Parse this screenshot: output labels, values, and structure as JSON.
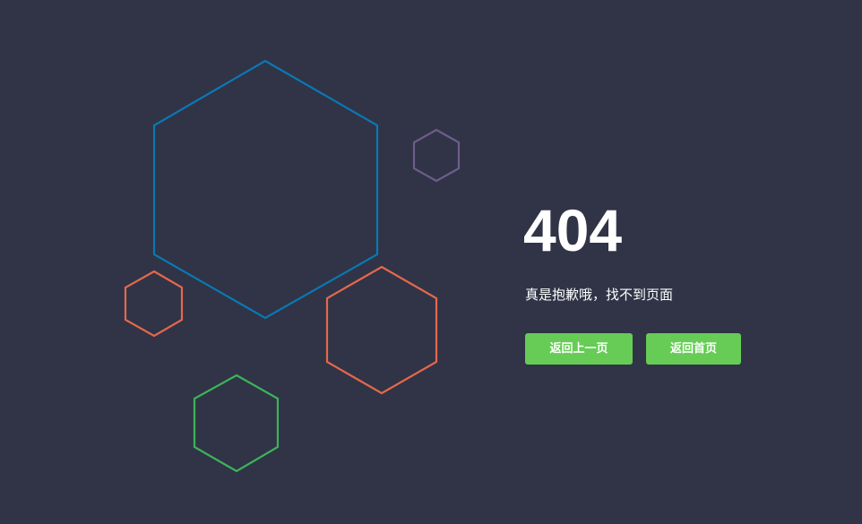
{
  "error": {
    "code": "404",
    "message": "真是抱歉哦，找不到页面"
  },
  "buttons": {
    "back_label": "返回上一页",
    "home_label": "返回首页"
  },
  "colors": {
    "background": "#303446",
    "text": "#ffffff",
    "button": "#66cc55",
    "hex_blue": "#0a78b4",
    "hex_purple": "#6e5c8c",
    "hex_orange": "#e4684c",
    "hex_green": "#3cb45a"
  },
  "decorations": [
    {
      "name": "hexagon-large-blue",
      "color_key": "hex_blue"
    },
    {
      "name": "hexagon-small-purple",
      "color_key": "hex_purple"
    },
    {
      "name": "hexagon-small-orange",
      "color_key": "hex_orange"
    },
    {
      "name": "hexagon-medium-orange",
      "color_key": "hex_orange"
    },
    {
      "name": "hexagon-medium-green",
      "color_key": "hex_green"
    }
  ]
}
